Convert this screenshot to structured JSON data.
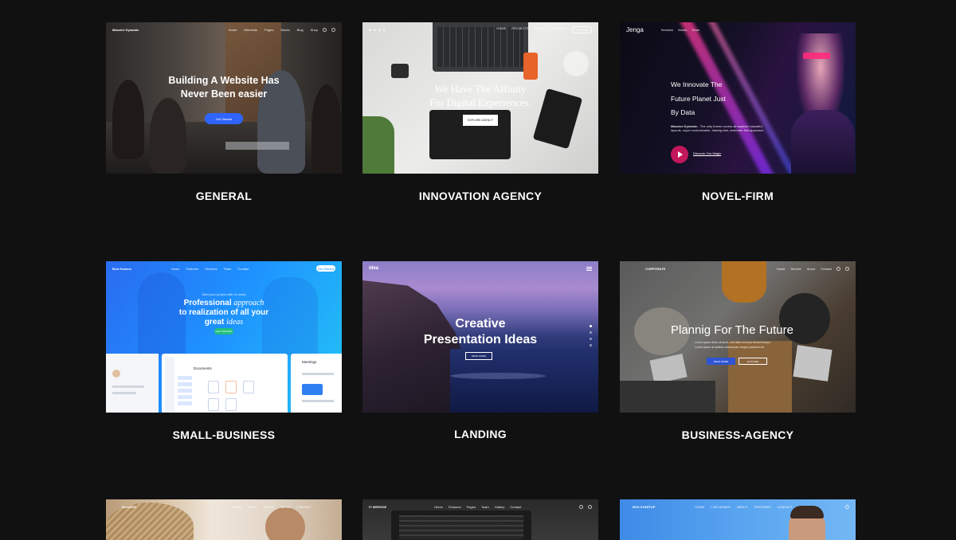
{
  "themes": [
    {
      "caption": "GENERAL",
      "brand": "Massive Dynamic",
      "nav": [
        "Home",
        "Elements",
        "Pages",
        "Works",
        "Blog",
        "Shop"
      ],
      "headline1": "Building A Website Has",
      "headline2": "Never Been easier",
      "button": "Get Started"
    },
    {
      "caption": "INNOVATION AGENCY",
      "brand": "M A S S",
      "nav": [
        "HOME",
        "PROJECTS",
        "ABOUT",
        "PROCESS",
        "CONTACT"
      ],
      "headline1": "We Have The Affinity",
      "headline2": "For Digital Experiences.",
      "button": "EXPLORE AGENCY"
    },
    {
      "caption": "NOVEL-FIRM",
      "brand": "Jenga",
      "nav": [
        "Services",
        "Works",
        "Team"
      ],
      "headline1": "We Innovate The",
      "headline2": "Future Planet Just",
      "headline3": "By Data",
      "body_bold": "Massive Dynamic",
      "body": " - The only theme covers all aspects: beautiful layouts, super customizable, blazing fast, customer first approach.",
      "button": "Discover Our Magic"
    },
    {
      "caption": "SMALL-BUSINESS",
      "brand": "Best Scaens",
      "nav": [
        "Home",
        "Features",
        "Services",
        "Team",
        "Contact"
      ],
      "cta": "Get Started",
      "eyebrow": "Start your project with us today",
      "headline1": "Professional",
      "headline1b": "approach",
      "headline2": "to realization of all your",
      "headline3": "great",
      "headline3b": "ideas",
      "button": "GET STARTED",
      "panel1": "Documents",
      "panel2": "Meetings"
    },
    {
      "caption": "LANDING",
      "brand": "idea",
      "headline1": "Creative",
      "headline2": "Presentation Ideas",
      "button": "READ MORE"
    },
    {
      "caption": "BUSINESS-AGENCY",
      "brand": "CORPORATE",
      "nav": [
        "Home",
        "Service",
        "About",
        "Contact"
      ],
      "headline1": "Plannig For The Future",
      "subline1": "Lorem ipsum dolor sit amet, sed diam nonumy eirmod tempor",
      "subline2": "Lorem ipsum at facilisis ullamcorper cingue praesent vel",
      "button1": "READ MORE",
      "button2": "EXPLORE"
    },
    {
      "caption": "",
      "brand": "MASSIVE",
      "nav": [
        "HOME",
        "SHOP",
        "ABOUT",
        "BLOG",
        "CONTACT"
      ]
    },
    {
      "caption": "",
      "brand": "IT SERVICE",
      "nav": [
        "Home",
        "Features",
        "Pages",
        "Team",
        "Gallery",
        "Contact"
      ]
    },
    {
      "caption": "",
      "brand": "BOX STARTUP",
      "nav": [
        "HOME",
        "LIVE DEMOS",
        "ABOUT",
        "FEATURES",
        "CONTACT"
      ]
    }
  ],
  "colors": {
    "page_bg": "#111112",
    "general_btn": "#2f64ff",
    "innovation_accent": "#e8632a",
    "novel_btn": "#c2185b",
    "small_business_grad": "#1e90ff",
    "business_btn": "#2f55d4"
  }
}
